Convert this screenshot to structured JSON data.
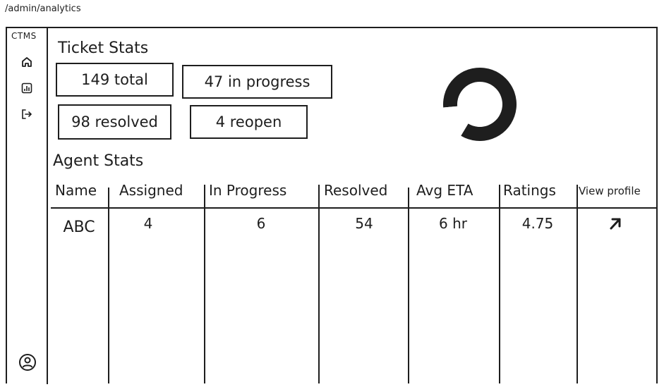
{
  "route": "/admin/analytics",
  "app": {
    "brand": "CTMS"
  },
  "sidebar": {
    "items": [
      {
        "icon": "home-icon"
      },
      {
        "icon": "analytics-icon"
      },
      {
        "icon": "logout-icon"
      }
    ],
    "profile_icon": "user-circle-icon"
  },
  "ticket_stats": {
    "title": "Ticket Stats",
    "total": "149 total",
    "in_progress": "47 in progress",
    "resolved": "98 resolved",
    "reopen": "4 reopen"
  },
  "chart_data": {
    "type": "pie",
    "donut": true,
    "categories": [
      "filled",
      "remaining"
    ],
    "values": [
      85,
      15
    ],
    "colors": [
      "#1e1e1e",
      "#ffffff"
    ]
  },
  "agent_stats": {
    "title": "Agent Stats",
    "columns": [
      "Name",
      "Assigned",
      "In Progress",
      "Resolved",
      "Avg ETA",
      "Ratings",
      "View profile"
    ],
    "rows": [
      {
        "name": "ABC",
        "assigned": "4",
        "in_progress": "6",
        "resolved": "54",
        "avg_eta": "6 hr",
        "ratings": "4.75",
        "view_icon": "arrow-up-left-icon"
      }
    ]
  }
}
